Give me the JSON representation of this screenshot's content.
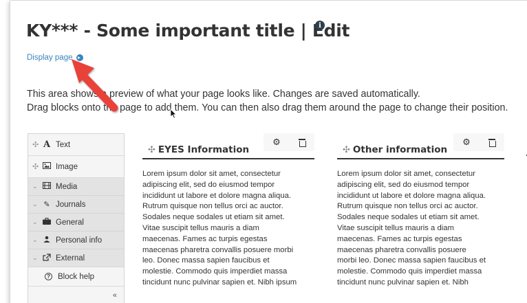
{
  "page": {
    "title": "KY*** - Some important title | Edit",
    "info_icon": "info-circle-icon",
    "display_link": "Display page",
    "intro_lines": [
      "This area shows a preview of what your page looks like. Changes are saved automatically.",
      "Drag blocks onto the page to add them. You can then also drag them around the page to change their position."
    ]
  },
  "sidebar": {
    "items": [
      {
        "label": "Text",
        "icon": "text-icon",
        "type": "block"
      },
      {
        "label": "Image",
        "icon": "image-icon",
        "type": "block"
      },
      {
        "label": "Media",
        "icon": "film-icon",
        "type": "category"
      },
      {
        "label": "Journals",
        "icon": "pencil-icon",
        "type": "category"
      },
      {
        "label": "General",
        "icon": "briefcase-icon",
        "type": "category"
      },
      {
        "label": "Personal info",
        "icon": "user-icon",
        "type": "category"
      },
      {
        "label": "External",
        "icon": "external-link-icon",
        "type": "category"
      }
    ],
    "help_label": "Block help",
    "collapse_label": "«"
  },
  "blocks": [
    {
      "title": "EYES Information",
      "lines": [
        "Lorem ipsum dolor sit amet, consectetur",
        "adipiscing elit, sed do eiusmod tempor",
        "incididunt ut labore et dolore magna aliqua.",
        "Rutrum quisque non tellus orci ac auctor.",
        "Sodales neque sodales ut etiam sit amet.",
        "Vitae suscipit tellus mauris a diam",
        "maecenas. Fames ac turpis egestas",
        "maecenas pharetra convallis posuere morbi",
        "leo. Donec massa sapien faucibus et",
        "molestie. Commodo quis imperdiet massa",
        "tincidunt nunc pulvinar sapien et. Nibh ipsum"
      ]
    },
    {
      "title": "Other information",
      "lines": [
        "Lorem ipsum dolor sit amet, consectetur",
        "adipiscing elit, sed do eiusmod tempor",
        "incididunt ut labore et dolore magna aliqua.",
        "Rutrum quisque non tellus orci ac auctor.",
        "Sodales neque sodales ut etiam sit amet.",
        "Vitae suscipit tellus mauris a diam",
        "maecenas. Fames ac turpis egestas",
        "maecenas pharetra convallis posuere",
        "morbi leo. Donec massa sapien faucibus et",
        "molestie. Commodo quis imperdiet massa",
        "tincidunt nunc pulvinar sapien et. Nibh"
      ]
    }
  ],
  "colors": {
    "link": "#3b83bd",
    "annotation_arrow": "#e8433a",
    "sidebar_bg": "#ececec"
  }
}
